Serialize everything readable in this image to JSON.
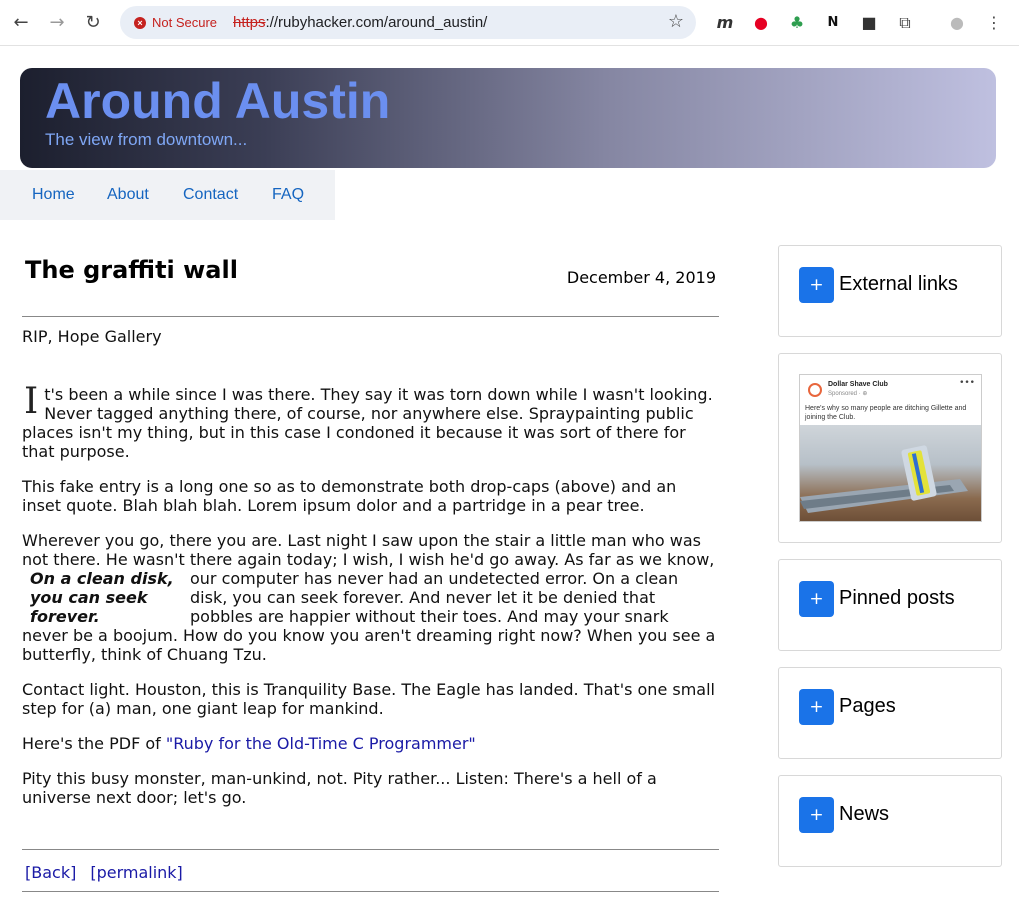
{
  "browser": {
    "security_label": "Not Secure",
    "url_scheme": "https",
    "url_rest": "://rubyhacker.com/around_austin/"
  },
  "site": {
    "title": "Around Austin",
    "subtitle": "The view from downtown...",
    "nav": [
      "Home",
      "About",
      "Contact",
      "FAQ"
    ]
  },
  "post": {
    "title": "The graffiti wall",
    "date": "December 4, 2019",
    "subtitle": "RIP, Hope Gallery",
    "dropcap": "I",
    "p1": "t's been a while since I was there. They say it was torn down while I wasn't looking. Never tagged anything there, of course, nor anywhere else. Spraypainting public places isn't my thing, but in this case I condoned it because it was sort of there for that purpose.",
    "p2": "This fake entry is a long one so as to demonstrate both drop-caps (above) and an inset quote. Blah blah blah. Lorem ipsum dolor and a partridge in a pear tree.",
    "p3_lead": "Wherever you go, there you are. Last night I saw upon the stair a little man who was not there. He wasn't there again today; I wish, I wish he'd go away. As far as we",
    "pullquote": "On a clean disk, you can seek forever.",
    "p3_rest": "know, our computer has never had an undetected error. On a clean disk, you can seek forever. And never let it be denied that pobbles are happier without their toes. And may your snark never be a boojum. How do you know you aren't dreaming right now? When you see a butterfly, think of Chuang Tzu.",
    "p4": "Contact light. Houston, this is Tranquility Base. The Eagle has landed. That's one small step for (a) man, one giant leap for mankind.",
    "p5_prefix": "Here's the PDF of ",
    "p5_link": "\"Ruby for the Old-Time C Programmer\"",
    "p6": "Pity this busy monster, man-unkind, not. Pity rather... Listen: There's a hell of a universe next door; let's go.",
    "back_link": "[Back]",
    "permalink": "[permalink]"
  },
  "sidebar": {
    "plus_label": "+",
    "widgets": [
      "External links",
      "Pinned posts",
      "Pages",
      "News"
    ],
    "ad": {
      "brand": "Dollar Shave Club",
      "sponsored": "Sponsored · ⊕",
      "copy": "Here's why so many people are ditching Gillette and joining the Club."
    }
  }
}
